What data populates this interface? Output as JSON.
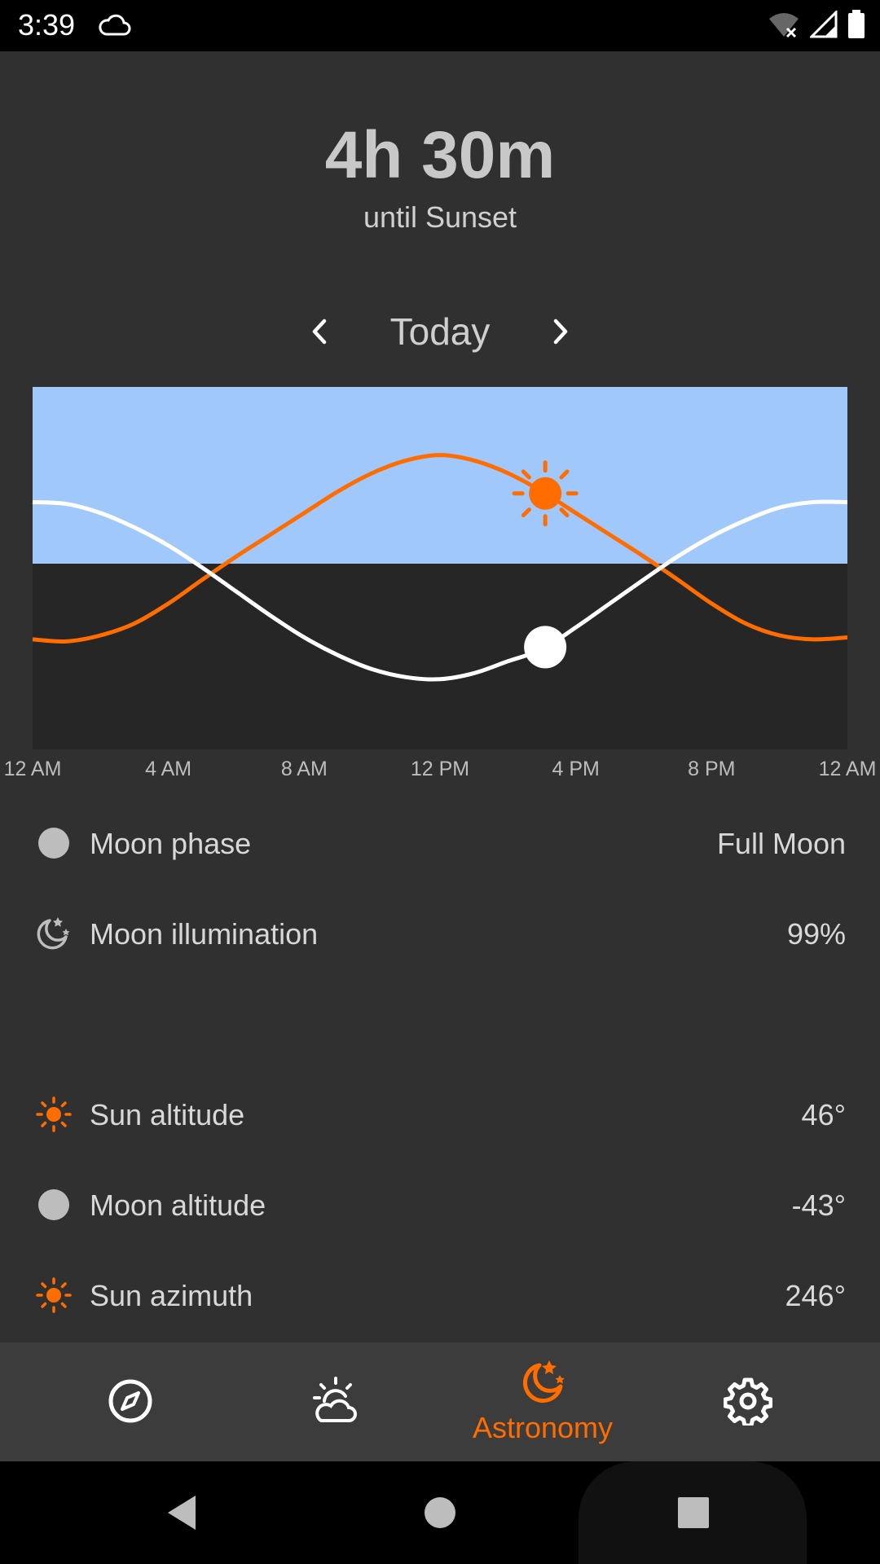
{
  "status_bar": {
    "time": "3:39"
  },
  "header": {
    "countdown": "4h 30m",
    "subtitle": "until Sunset"
  },
  "day_nav": {
    "label": "Today"
  },
  "chart_data": {
    "type": "line",
    "x_tick_labels": [
      "12 AM",
      "4 AM",
      "8 AM",
      "12 PM",
      "4 PM",
      "8 PM",
      "12 AM"
    ],
    "xlim_hours": [
      0,
      24
    ],
    "series": [
      {
        "color": "#ff6d00",
        "x_hours": [
          0,
          1,
          2,
          3,
          4,
          5,
          6,
          7,
          8,
          9,
          10,
          11,
          12,
          13,
          14,
          15,
          16,
          17,
          18,
          19,
          20,
          21,
          22,
          23,
          24
        ],
        "y": [
          -38,
          -39,
          -36,
          -30,
          -20,
          -8,
          4,
          16,
          28,
          40,
          50,
          57,
          60,
          57,
          50,
          40,
          28,
          16,
          4,
          -8,
          -20,
          -30,
          -36,
          -38,
          -37
        ],
        "marker_x_hours": 15.1
      },
      {
        "color": "#ffffff",
        "x_hours": [
          0,
          1,
          2,
          3,
          4,
          5,
          6,
          7,
          8,
          9,
          10,
          11,
          12,
          13,
          14,
          15,
          16,
          17,
          18,
          19,
          20,
          21,
          22,
          23,
          24
        ],
        "y": [
          34,
          33,
          28,
          20,
          10,
          -2,
          -14,
          -26,
          -37,
          -46,
          -53,
          -57,
          -58,
          -55,
          -49,
          -43,
          -32,
          -20,
          -8,
          4,
          15,
          24,
          31,
          34,
          34
        ],
        "marker_x_hours": 15.1
      }
    ],
    "horizon_y": 0,
    "ylim": [
      -90,
      90
    ],
    "colors": {
      "day_sky": "#a0c8fa",
      "night_sky": "#262626"
    }
  },
  "info_rows": [
    {
      "icon": "moon-phase-icon",
      "label": "Moon phase",
      "value": "Full Moon"
    },
    {
      "icon": "moon-stars-icon",
      "label": "Moon illumination",
      "value": "99%"
    },
    {
      "icon": "sun-icon",
      "label": "Sun altitude",
      "value": "46°"
    },
    {
      "icon": "moon-phase-icon",
      "label": "Moon altitude",
      "value": "-43°"
    },
    {
      "icon": "sun-icon",
      "label": "Sun azimuth",
      "value": "246°"
    }
  ],
  "bottom_nav": {
    "items": [
      {
        "icon": "compass-icon",
        "label": ""
      },
      {
        "icon": "weather-icon",
        "label": ""
      },
      {
        "icon": "astronomy-icon",
        "label": "Astronomy",
        "active": true
      },
      {
        "icon": "settings-icon",
        "label": ""
      }
    ],
    "accent_color": "#ff6d00"
  }
}
